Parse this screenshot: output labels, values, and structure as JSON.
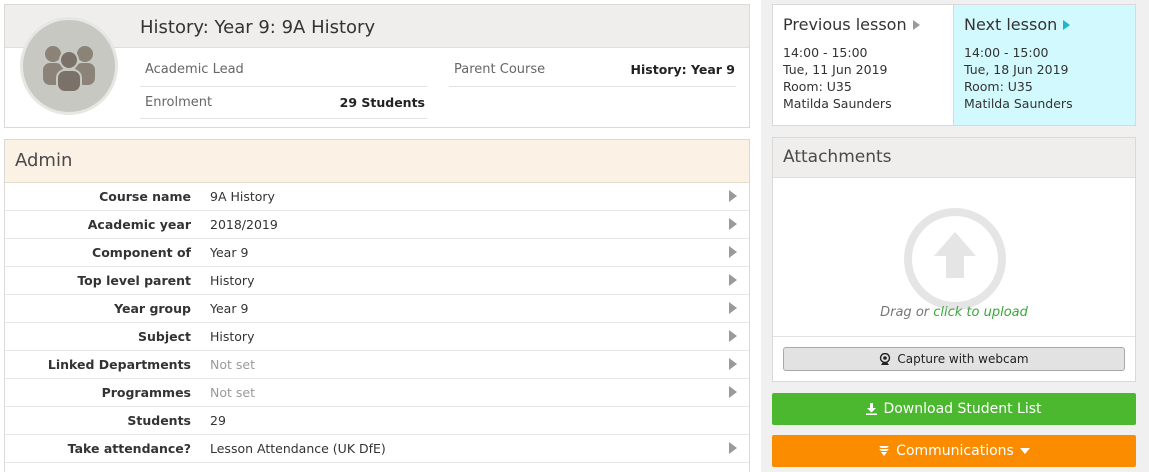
{
  "header": {
    "title": "History: Year 9: 9A History",
    "academic_lead_label": "Academic Lead",
    "academic_lead_value": "",
    "parent_course_label": "Parent Course",
    "parent_course_value": "History: Year 9",
    "enrolment_label": "Enrolment",
    "enrolment_value": "29 Students"
  },
  "admin": {
    "title": "Admin",
    "rows": [
      {
        "label": "Course name",
        "value": "9A History"
      },
      {
        "label": "Academic year",
        "value": "2018/2019"
      },
      {
        "label": "Component of",
        "value": "Year 9"
      },
      {
        "label": "Top level parent",
        "value": "History"
      },
      {
        "label": "Year group",
        "value": "Year 9"
      },
      {
        "label": "Subject",
        "value": "History"
      },
      {
        "label": "Linked Departments",
        "value": "Not set"
      },
      {
        "label": "Programmes",
        "value": "Not set"
      },
      {
        "label": "Students",
        "value": "29"
      },
      {
        "label": "Take attendance?",
        "value": "Lesson Attendance (UK DfE)"
      }
    ]
  },
  "lessons": {
    "previous": {
      "title": "Previous lesson",
      "time": "14:00 - 15:00",
      "date": "Tue, 11 Jun 2019",
      "room": "Room: U35",
      "teacher": "Matilda Saunders"
    },
    "next": {
      "title": "Next lesson",
      "time": "14:00 - 15:00",
      "date": "Tue, 18 Jun 2019",
      "room": "Room: U35",
      "teacher": "Matilda Saunders"
    }
  },
  "attachments": {
    "title": "Attachments",
    "drag_text": "Drag or ",
    "upload_link": "click to upload",
    "webcam_label": "Capture with webcam"
  },
  "actions": {
    "download_label": "Download Student List",
    "communications_label": "Communications"
  },
  "colors": {
    "next_lesson_bg": "#d2f9fd",
    "admin_header_bg": "#fcf1e5",
    "download_green": "#4cb830",
    "communications_orange": "#fb8c00",
    "upload_link_green": "#3aa83a"
  }
}
